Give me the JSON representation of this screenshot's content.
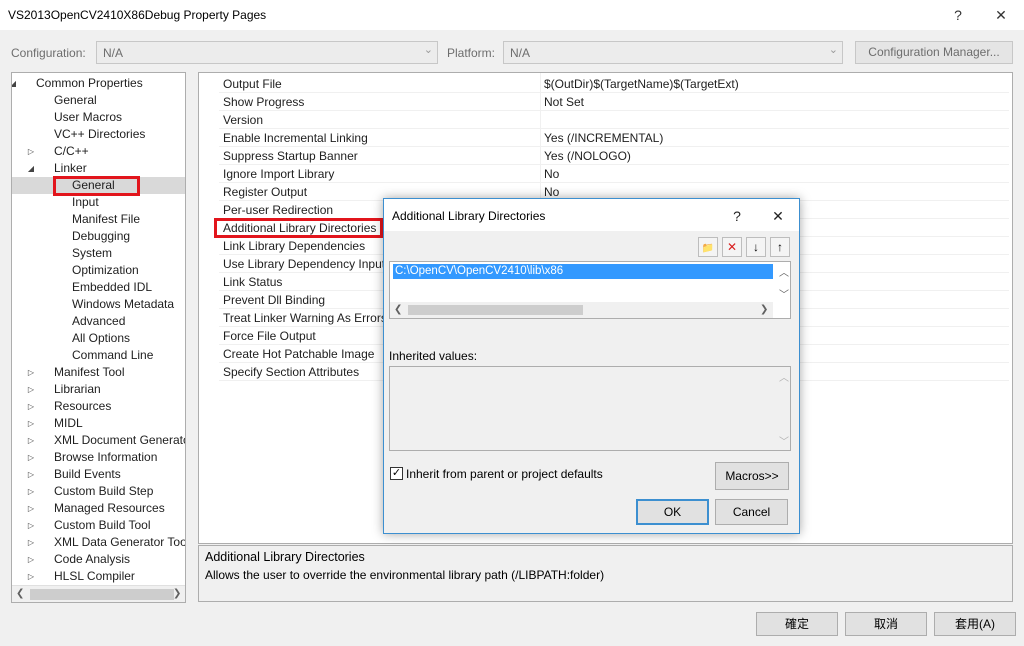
{
  "window": {
    "title": "VS2013OpenCV2410X86Debug Property Pages",
    "help_glyph": "?",
    "close_glyph": "✕"
  },
  "config_row": {
    "configuration_label": "Configuration:",
    "configuration_value": "N/A",
    "platform_label": "Platform:",
    "platform_value": "N/A",
    "manager_label": "Configuration Manager..."
  },
  "tree": {
    "items": [
      {
        "label": "Common Properties",
        "level": 0,
        "expander": "◢",
        "selected": false
      },
      {
        "label": "General",
        "level": 1,
        "expander": "",
        "selected": false
      },
      {
        "label": "User Macros",
        "level": 1,
        "expander": "",
        "selected": false
      },
      {
        "label": "VC++ Directories",
        "level": 1,
        "expander": "",
        "selected": false
      },
      {
        "label": "C/C++",
        "level": 1,
        "expander": "▷",
        "selected": false
      },
      {
        "label": "Linker",
        "level": 1,
        "expander": "◢",
        "selected": false
      },
      {
        "label": "General",
        "level": 2,
        "expander": "",
        "selected": true
      },
      {
        "label": "Input",
        "level": 2,
        "expander": "",
        "selected": false
      },
      {
        "label": "Manifest File",
        "level": 2,
        "expander": "",
        "selected": false
      },
      {
        "label": "Debugging",
        "level": 2,
        "expander": "",
        "selected": false
      },
      {
        "label": "System",
        "level": 2,
        "expander": "",
        "selected": false
      },
      {
        "label": "Optimization",
        "level": 2,
        "expander": "",
        "selected": false
      },
      {
        "label": "Embedded IDL",
        "level": 2,
        "expander": "",
        "selected": false
      },
      {
        "label": "Windows Metadata",
        "level": 2,
        "expander": "",
        "selected": false
      },
      {
        "label": "Advanced",
        "level": 2,
        "expander": "",
        "selected": false
      },
      {
        "label": "All Options",
        "level": 2,
        "expander": "",
        "selected": false
      },
      {
        "label": "Command Line",
        "level": 2,
        "expander": "",
        "selected": false
      },
      {
        "label": "Manifest Tool",
        "level": 1,
        "expander": "▷",
        "selected": false
      },
      {
        "label": "Librarian",
        "level": 1,
        "expander": "▷",
        "selected": false
      },
      {
        "label": "Resources",
        "level": 1,
        "expander": "▷",
        "selected": false
      },
      {
        "label": "MIDL",
        "level": 1,
        "expander": "▷",
        "selected": false
      },
      {
        "label": "XML Document Generato",
        "level": 1,
        "expander": "▷",
        "selected": false
      },
      {
        "label": "Browse Information",
        "level": 1,
        "expander": "▷",
        "selected": false
      },
      {
        "label": "Build Events",
        "level": 1,
        "expander": "▷",
        "selected": false
      },
      {
        "label": "Custom Build Step",
        "level": 1,
        "expander": "▷",
        "selected": false
      },
      {
        "label": "Managed Resources",
        "level": 1,
        "expander": "▷",
        "selected": false
      },
      {
        "label": "Custom Build Tool",
        "level": 1,
        "expander": "▷",
        "selected": false
      },
      {
        "label": "XML Data Generator Too",
        "level": 1,
        "expander": "▷",
        "selected": false
      },
      {
        "label": "Code Analysis",
        "level": 1,
        "expander": "▷",
        "selected": false
      },
      {
        "label": "HLSL Compiler",
        "level": 1,
        "expander": "▷",
        "selected": false
      }
    ]
  },
  "grid": {
    "rows": [
      {
        "name": "Output File",
        "value": "$(OutDir)$(TargetName)$(TargetExt)"
      },
      {
        "name": "Show Progress",
        "value": "Not Set"
      },
      {
        "name": "Version",
        "value": ""
      },
      {
        "name": "Enable Incremental Linking",
        "value": "Yes (/INCREMENTAL)"
      },
      {
        "name": "Suppress Startup Banner",
        "value": "Yes (/NOLOGO)"
      },
      {
        "name": "Ignore Import Library",
        "value": "No"
      },
      {
        "name": "Register Output",
        "value": "No"
      },
      {
        "name": "Per-user Redirection",
        "value": ""
      },
      {
        "name": "Additional Library Directories",
        "value": ""
      },
      {
        "name": "Link Library Dependencies",
        "value": ""
      },
      {
        "name": "Use Library Dependency Input",
        "value": ""
      },
      {
        "name": "Link Status",
        "value": ""
      },
      {
        "name": "Prevent Dll Binding",
        "value": ""
      },
      {
        "name": "Treat Linker Warning As Errors",
        "value": ""
      },
      {
        "name": "Force File Output",
        "value": ""
      },
      {
        "name": "Create Hot Patchable Image",
        "value": ""
      },
      {
        "name": "Specify Section Attributes",
        "value": ""
      }
    ]
  },
  "description": {
    "title": "Additional Library Directories",
    "text": "Allows the user to override the environmental library path (/LIBPATH:folder)"
  },
  "buttons": {
    "ok": "確定",
    "cancel": "取消",
    "apply": "套用(A)"
  },
  "dialog": {
    "title": "Additional Library Directories",
    "help_glyph": "?",
    "close_glyph": "✕",
    "directories": [
      "C:\\OpenCV\\OpenCV2410\\lib\\x86"
    ],
    "inherited_label": "Inherited values:",
    "inherit_checkbox_label": "Inherit from parent or project defaults",
    "inherit_checked": true,
    "macros_button": "Macros>>",
    "ok_button": "OK",
    "cancel_button": "Cancel",
    "toolbar": [
      {
        "icon": "new-folder-icon",
        "glyph": "📁",
        "color": "#d9a441"
      },
      {
        "icon": "delete-icon",
        "glyph": "✕",
        "color": "#d81e1e"
      },
      {
        "icon": "move-down-icon",
        "glyph": "↓",
        "color": "#222222"
      },
      {
        "icon": "move-up-icon",
        "glyph": "↑",
        "color": "#222222"
      }
    ]
  },
  "colors": {
    "highlight_red": "#e2151c",
    "selection_blue": "#3399ff",
    "dialog_border": "#3c8fd0"
  }
}
